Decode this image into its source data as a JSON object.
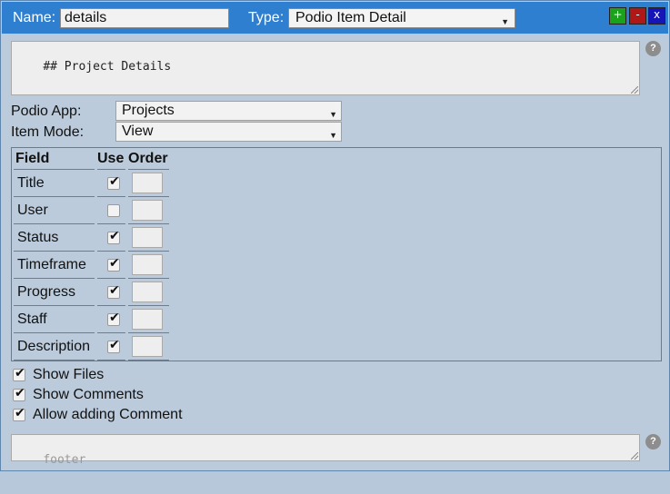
{
  "header": {
    "name_label": "Name:",
    "name_value": "details",
    "type_label": "Type:",
    "type_value": "Podio Item Detail",
    "add_label": "+",
    "remove_label": "-",
    "close_label": "x",
    "colors": {
      "bar": "#2f7fd1",
      "add": "#1aa31a",
      "remove": "#b01818",
      "close": "#1616b8"
    }
  },
  "content_text": "## Project Details",
  "help_glyph": "?",
  "podio_app": {
    "label": "Podio App:",
    "value": "Projects"
  },
  "item_mode": {
    "label": "Item Mode:",
    "value": "View"
  },
  "fields_table": {
    "headers": {
      "field": "Field",
      "use": "Use",
      "order": "Order"
    },
    "rows": [
      {
        "field": "Title",
        "use": true,
        "order": ""
      },
      {
        "field": "User",
        "use": false,
        "order": ""
      },
      {
        "field": "Status",
        "use": true,
        "order": ""
      },
      {
        "field": "Timeframe",
        "use": true,
        "order": ""
      },
      {
        "field": "Progress",
        "use": true,
        "order": ""
      },
      {
        "field": "Staff",
        "use": true,
        "order": ""
      },
      {
        "field": "Description",
        "use": true,
        "order": ""
      }
    ]
  },
  "options": [
    {
      "label": "Show Files",
      "checked": true
    },
    {
      "label": "Show Comments",
      "checked": true
    },
    {
      "label": "Allow adding Comment",
      "checked": true
    }
  ],
  "footer_placeholder": "footer"
}
